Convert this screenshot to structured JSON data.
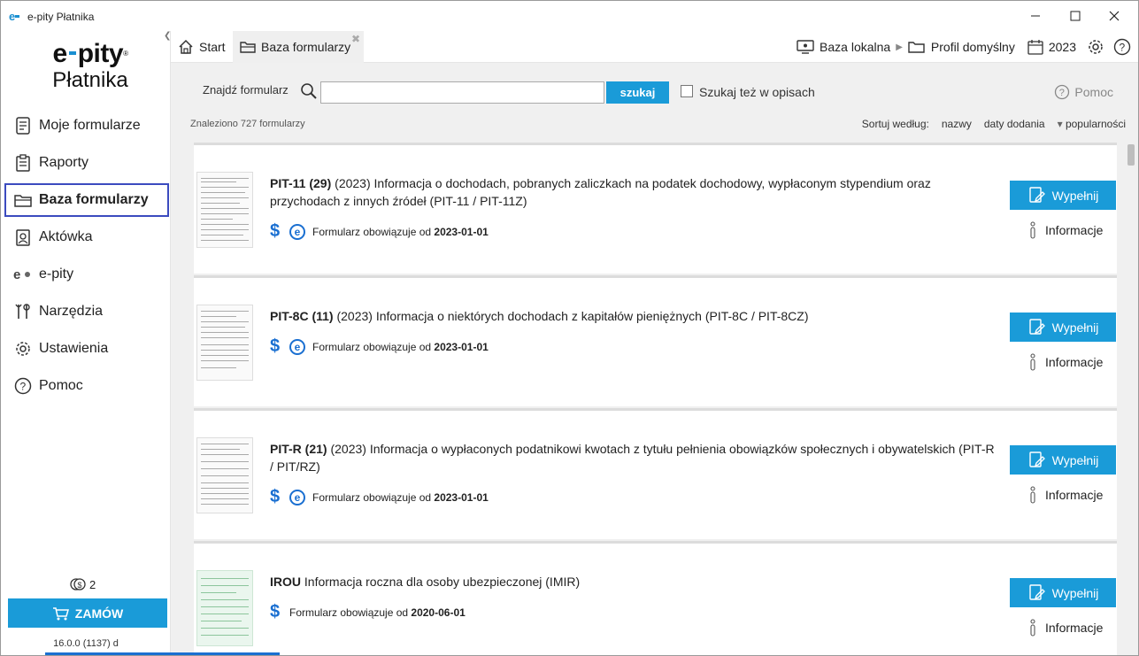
{
  "window": {
    "title": "e-pity Płatnika",
    "logo_letter": "e"
  },
  "sidebar": {
    "brand_line1": "e",
    "brand_line1b": "pity",
    "brand_reg": "®",
    "brand_line2": "Płatnika",
    "items": [
      {
        "label": "Moje formularze",
        "icon": "document-icon"
      },
      {
        "label": "Raporty",
        "icon": "clipboard-icon"
      },
      {
        "label": "Baza formularzy",
        "icon": "folder-icon",
        "active": true
      },
      {
        "label": "Aktówka",
        "icon": "briefcase-icon"
      },
      {
        "label": "e-pity",
        "icon": "epity-icon"
      },
      {
        "label": "Narzędzia",
        "icon": "tools-icon"
      },
      {
        "label": "Ustawienia",
        "icon": "gear-icon"
      },
      {
        "label": "Pomoc",
        "icon": "help-icon"
      }
    ],
    "coins": "2",
    "order_label": "ZAMÓW",
    "version": "16.0.0 (1137) d"
  },
  "tabs": [
    {
      "label": "Start",
      "icon": "home-icon"
    },
    {
      "label": "Baza formularzy",
      "icon": "folder-icon",
      "active": true
    }
  ],
  "topbar": {
    "db_label": "Baza lokalna",
    "profile_label": "Profil domyślny",
    "year": "2023"
  },
  "search": {
    "label": "Znajdź formularz",
    "value": "",
    "button": "szukaj",
    "checkbox_label": "Szukaj też w opisach",
    "help": "Pomoc"
  },
  "results": {
    "found": "Znaleziono 727 formularzy",
    "sort_label": "Sortuj według:",
    "sort_options": [
      "nazwy",
      "daty dodania",
      "popularności"
    ]
  },
  "forms": [
    {
      "code": "PIT-11 (29)",
      "desc": " (2023) Informacja o dochodach, pobranych zaliczkach na podatek dochodowy, wypłaconym stypendium oraz przychodach z innych źródeł  (PIT-11 / PIT-11Z)",
      "valid_text": "Formularz obowiązuje od ",
      "valid_date": "2023-01-01",
      "epit": true
    },
    {
      "code": "PIT-8C (11)",
      "desc": " (2023) Informacja o niektórych dochodach z kapitałów pieniężnych (PIT-8C / PIT-8CZ)",
      "valid_text": "Formularz obowiązuje od ",
      "valid_date": "2023-01-01",
      "epit": true
    },
    {
      "code": "PIT-R (21)",
      "desc": " (2023) Informacja o wypłaconych podatnikowi kwotach z tytułu pełnienia obowiązków społecznych i obywatelskich (PIT-R / PIT/RZ)",
      "valid_text": "Formularz obowiązuje od ",
      "valid_date": "2023-01-01",
      "epit": true
    },
    {
      "code": "IROU",
      "desc": " Informacja roczna dla osoby ubezpieczonej (IMIR)",
      "valid_text": "Formularz obowiązuje od ",
      "valid_date": "2020-06-01",
      "epit": false
    }
  ],
  "buttons": {
    "fill": "Wypełnij",
    "info": "Informacje"
  },
  "colors": {
    "accent": "#1a9bd8",
    "active_border": "#3b4bbf"
  }
}
